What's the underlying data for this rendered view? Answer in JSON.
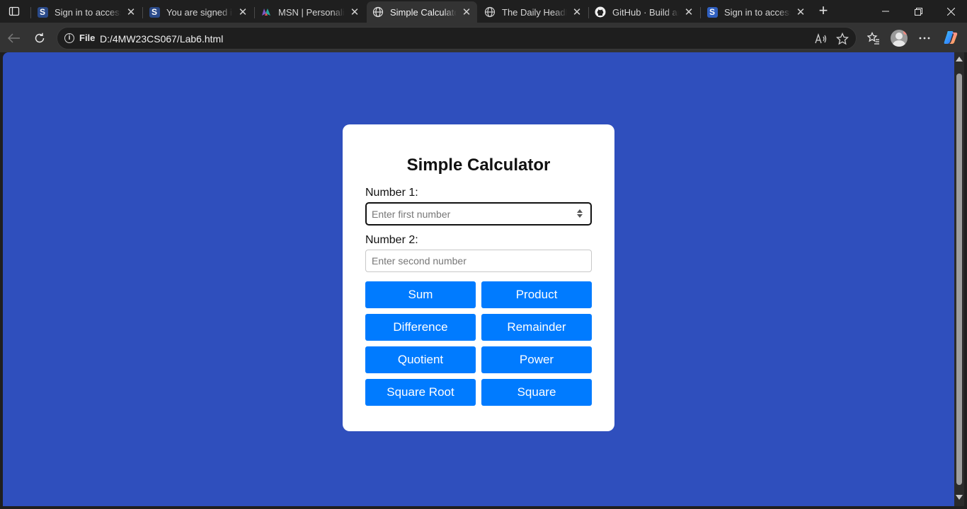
{
  "browser": {
    "tabs": [
      {
        "title": "Sign in to access the",
        "favicon": "s-logo-icon",
        "active": false
      },
      {
        "title": "You are signed in as",
        "favicon": "s-logo-icon",
        "active": false
      },
      {
        "title": "MSN | Personalized",
        "favicon": "msn-icon",
        "active": false
      },
      {
        "title": "Simple Calculator",
        "favicon": "globe-icon",
        "active": true
      },
      {
        "title": "The Daily Headlines",
        "favicon": "globe-icon",
        "active": false
      },
      {
        "title": "GitHub · Build and ship",
        "favicon": "github-icon",
        "active": false
      },
      {
        "title": "Sign in to access the",
        "favicon": "s-logo-icon",
        "active": false
      }
    ],
    "address": {
      "scheme_label": "File",
      "url": "D:/4MW23CS067/Lab6.html"
    },
    "colors": {
      "page_background": "#2f4fbd",
      "button": "#007bff"
    }
  },
  "calculator": {
    "title": "Simple Calculator",
    "number1": {
      "label": "Number 1:",
      "placeholder": "Enter first number",
      "value": ""
    },
    "number2": {
      "label": "Number 2:",
      "placeholder": "Enter second number",
      "value": ""
    },
    "buttons": {
      "sum": "Sum",
      "product": "Product",
      "difference": "Difference",
      "remainder": "Remainder",
      "quotient": "Quotient",
      "power": "Power",
      "square_root": "Square Root",
      "square": "Square"
    }
  }
}
